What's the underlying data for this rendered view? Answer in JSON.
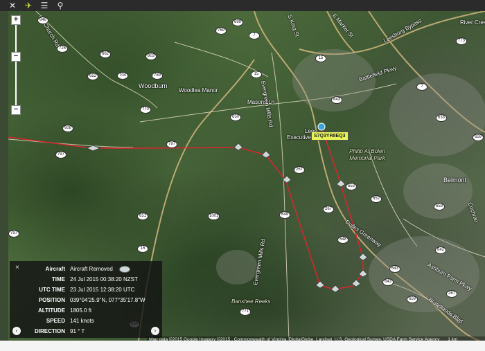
{
  "toolbar": {
    "icons": [
      "close-icon",
      "airplane-icon",
      "layers-icon",
      "search-icon"
    ]
  },
  "map": {
    "places": {
      "woodburn": "Woodburn",
      "woodlea_manor": "Woodlea Manor",
      "belmont": "Belmont",
      "river_crest": "River Crest",
      "philip_park": "Philip A. Bolen Memorial Park",
      "banshee_reeks": "Banshee Reeks",
      "executive": "Executive",
      "leesburg_partial": "Lees"
    },
    "roads": {
      "masons_ln": "Masons Ln",
      "evergreen_mills_rd_north": "Evergreen Mills Rd",
      "evergreen_mills_rd_south": "Evergreen Mills Rd",
      "dulles_greenway": "Dulles Greenway",
      "battlefield_pkwy": "Battlefield Pkwy",
      "ashburn_farm_pkwy": "Ashburn Farm Pkwy",
      "broadlands_blvd": "Broadlands Blvd",
      "market_st": "E Market St",
      "leesburg_bypass": "Leesburg Bypass",
      "church_rd": "ury Church Rd",
      "king_st": "S King St",
      "river_creek": "River Creek",
      "cochran": "Cochran"
    },
    "route_shields": [
      "848",
      "725",
      "662",
      "803",
      "652",
      "704",
      "789",
      "770",
      "608",
      "797",
      "797",
      "769",
      "699",
      "7",
      "15",
      "15",
      "650",
      "643",
      "7",
      "773",
      "633",
      "659",
      "653",
      "267",
      "267",
      "652",
      "659",
      "651",
      "1001",
      "649",
      "648",
      "642",
      "643",
      "643",
      "267",
      "659",
      "771",
      "15",
      "797",
      "650"
    ],
    "aircraft_callsign": "S7Q3YR8EQ3"
  },
  "zoom": {
    "plus": "+",
    "minus": "−"
  },
  "info_panel": {
    "close": "×",
    "rows": [
      {
        "label": "Aircraft",
        "value": "Aircraft Removed"
      },
      {
        "label": "TIME",
        "value": "24 Jul 2015 00:38:20 NZST"
      },
      {
        "label": "UTC TIME",
        "value": "23 Jul 2015 12:38:20 UTC"
      },
      {
        "label": "POSITION",
        "value": "039°04'25.9\"N, 077°35'17.8\"W"
      },
      {
        "label": "ALTITUDE",
        "value": "1805.0 ft"
      },
      {
        "label": "SPEED",
        "value": "141 knots"
      },
      {
        "label": "DIRECTION",
        "value": "91 ° T"
      }
    ],
    "nav_prev": "‹",
    "nav_next": "›"
  },
  "attribution": "Map data ©2015 Google Imagery ©2015 , Commonwealth of Virginia, DigitalGlobe, Landsat, U.S. Geological Survey, USDA Farm Service Agency",
  "scale": "1 km",
  "colors": {
    "track": "#d8262e",
    "callsign_bg": "#e6f25a",
    "panel_bg": "#141414"
  }
}
